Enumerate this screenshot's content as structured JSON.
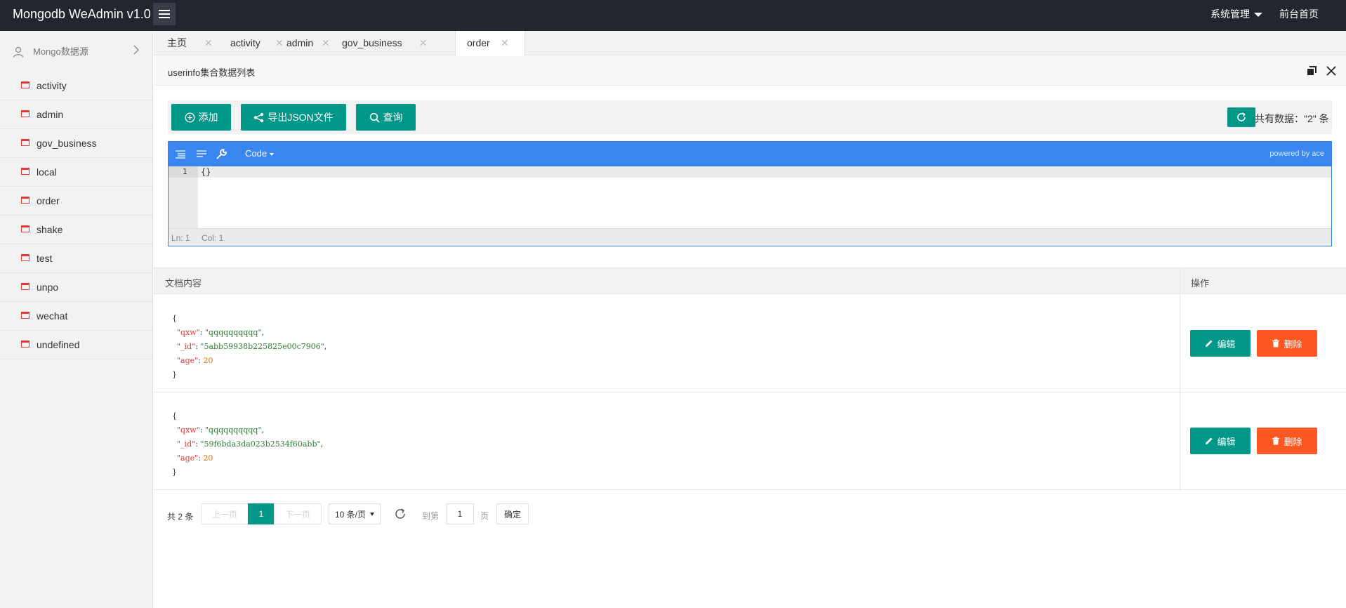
{
  "header": {
    "logo": "Mongodb WeAdmin v1.0",
    "nav_system": "系统管理",
    "nav_frontend": "前台首页"
  },
  "sidebar": {
    "heading": "Mongo数据源",
    "items": [
      {
        "label": "activity"
      },
      {
        "label": "admin"
      },
      {
        "label": "gov_business"
      },
      {
        "label": "local"
      },
      {
        "label": "order"
      },
      {
        "label": "shake"
      },
      {
        "label": "test"
      },
      {
        "label": "unpo"
      },
      {
        "label": "wechat"
      },
      {
        "label": "undefined"
      }
    ]
  },
  "tabs": [
    {
      "label": "主页"
    },
    {
      "label": "activity"
    },
    {
      "label": "admin"
    },
    {
      "label": "gov_business"
    },
    {
      "label": "order",
      "active": true
    }
  ],
  "page": {
    "title": "userinfo集合数据列表"
  },
  "toolbar": {
    "add_label": "添加",
    "export_label": "导出JSON文件",
    "query_label": "查询",
    "count_text": "共有数据：\"2\" 条"
  },
  "editor": {
    "mode_label": "Code",
    "powered_by": "powered by ace",
    "line_number": "1",
    "content": "{}",
    "status_ln": "Ln: 1",
    "status_col": "Col: 1"
  },
  "table": {
    "col_content": "文档内容",
    "col_actions": "操作",
    "edit_label": "编辑",
    "delete_label": "删除",
    "rows": [
      {
        "qxw": "qqqqqqqqqq",
        "id": "5abb59938b225825e00c7906",
        "age": "20"
      },
      {
        "qxw": "qqqqqqqqqq",
        "id": "59f6bda3da023b2534f60abb",
        "age": "20"
      }
    ]
  },
  "pager": {
    "total": "共 2 条",
    "prev": "上一页",
    "current": "1",
    "next": "下一页",
    "page_size": "10 条/页",
    "goto": "到第",
    "goto_value": "1",
    "page_unit": "页",
    "confirm": "确定"
  },
  "colors": {
    "primary": "#009688",
    "danger": "#ff5722",
    "header_bg": "#23262e",
    "editor_bar": "#3a86f0"
  }
}
